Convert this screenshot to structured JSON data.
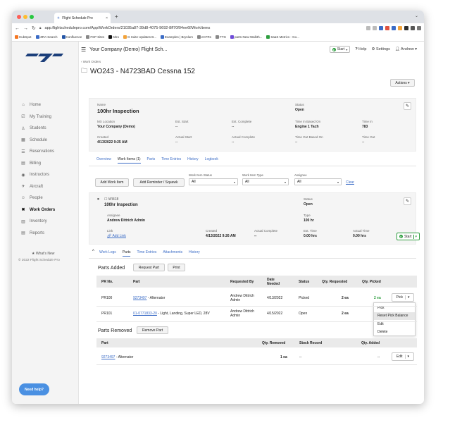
{
  "browser": {
    "tab_title": "Flight Schedule Pro",
    "url": "app.flightschedulepro.com/App/WorkOrders/21035a87-39d8-4075-9692-8ff70f04ee6f/WorkItems",
    "bookmarks": [
      "HubSpot",
      "JIRA Search",
      "Confluence",
      "FSP Sites",
      "Miro",
      "G Suite Updates B...",
      "Examples | Brynlum",
      "eCFRs",
      "FTG",
      "parts-New-Walkth...",
      "SaaS Metrics - Go..."
    ]
  },
  "header": {
    "company": "Your Company (Demo) Flight Sch...",
    "start_label": "Start",
    "help_label": "Help",
    "settings_label": "Settings",
    "user_label": "Andrew"
  },
  "sidebar": {
    "items": [
      {
        "label": "Home",
        "icon": "home-icon"
      },
      {
        "label": "My Training",
        "icon": "checklist-icon"
      },
      {
        "label": "Students",
        "icon": "student-icon"
      },
      {
        "label": "Schedule",
        "icon": "calendar-icon"
      },
      {
        "label": "Reservations",
        "icon": "list-icon"
      },
      {
        "label": "Billing",
        "icon": "billing-icon"
      },
      {
        "label": "Instructors",
        "icon": "instructor-icon"
      },
      {
        "label": "Aircraft",
        "icon": "aircraft-icon"
      },
      {
        "label": "People",
        "icon": "people-icon"
      },
      {
        "label": "Work Orders",
        "icon": "wrench-icon"
      },
      {
        "label": "Inventory",
        "icon": "inventory-icon"
      },
      {
        "label": "Reports",
        "icon": "reports-icon"
      }
    ],
    "whats_new": "What's New",
    "copyright": "© 2022 Flight Schedule Pro",
    "need_help": "Need help?"
  },
  "page": {
    "breadcrumb": "‹ Work Orders",
    "title": "WO243 - N4723BAD Cessna 152",
    "actions_label": "Actions"
  },
  "summary": {
    "name_label": "Name",
    "name": "100hr Inspection",
    "status_label": "Status",
    "status": "Open",
    "mx_location_label": "MX Location",
    "mx_location": "Your Company (Demo)",
    "est_start_label": "Est. Start",
    "est_start": "--",
    "est_complete_label": "Est. Complete",
    "est_complete": "--",
    "time_in_based_on_label": "Time In Based On",
    "time_in_based_on": "Engine 1 Tach",
    "time_in_label": "Time In",
    "time_in": "783",
    "created_label": "Created",
    "created": "4/13/2022 9:25 AM",
    "actual_start_label": "Actual Start",
    "actual_start": "--",
    "actual_complete_label": "Actual Complete",
    "actual_complete": "--",
    "time_out_based_on_label": "Time Out Based On",
    "time_out_based_on": "--",
    "time_out_label": "Time Out",
    "time_out": "--"
  },
  "wo_tabs": [
    "Overview",
    "Work Items (1)",
    "Parts",
    "Time Entries",
    "History",
    "Logbook"
  ],
  "filters": {
    "add_work_item": "Add Work Item",
    "add_reminder": "Add Reminder / Squawk",
    "status_label": "Work Item Status",
    "status_value": "All",
    "type_label": "Work Item Type",
    "type_value": "All",
    "assignee_label": "Assignee",
    "assignee_value": "All",
    "clear": "Clear"
  },
  "work_item": {
    "id": "WI418",
    "name": "100hr Inspection",
    "status_label": "Status",
    "status": "Open",
    "assignee_label": "Assignee",
    "assignee": "Andrew Dittrich Admin",
    "type_label": "Type",
    "type": "100 hr",
    "link_label": "Link",
    "link": "Add Link",
    "created_label": "Created",
    "created": "4/13/2022 9:26 AM",
    "actual_complete_label": "Actual Complete",
    "actual_complete": "--",
    "est_time_label": "Est. Time",
    "est_time": "0.00 hrs",
    "actual_time_label": "Actual Time",
    "actual_time": "0.00 hrs",
    "start_label": "Start"
  },
  "wi_tabs": [
    "Work Logs",
    "Parts",
    "Time Entries",
    "Attachments",
    "History"
  ],
  "parts_added": {
    "title": "Parts Added",
    "request_btn": "Request Part",
    "print_btn": "Print",
    "columns": [
      "PR No.",
      "Part",
      "Requested By",
      "Date Needed",
      "Status",
      "Qty. Requested",
      "Qty. Picked"
    ],
    "rows": [
      {
        "pr": "PR100",
        "part_no": "9273497",
        "part_desc": " - Alternator",
        "requested_by": "Andrew Dittrich Admin",
        "date": "4/13/2022",
        "status": "Picked",
        "qty_req": "2 ea",
        "qty_picked": "2 ea",
        "action": "Pick"
      },
      {
        "pr": "PR101",
        "part_no": "01-0771833-20",
        "part_desc": " - Light, Landing, Super LED, 28V",
        "requested_by": "Andrew Dittrich Admin",
        "date": "4/15/2022",
        "status": "Open",
        "qty_req": "2 ea",
        "qty_picked": "",
        "action": ""
      }
    ]
  },
  "dropdown": [
    "Pick",
    "Reset Pick Balance",
    "Edit",
    "Delete"
  ],
  "parts_removed": {
    "title": "Parts Removed",
    "remove_btn": "Remove Part",
    "columns": [
      "Part",
      "Qty. Removed",
      "Stock Record",
      "Qty. Added"
    ],
    "rows": [
      {
        "part_no": "9273497",
        "part_desc": " - Alternator",
        "qty_removed": "1 ea",
        "stock_record": "--",
        "qty_added": "--",
        "action": "Edit"
      }
    ]
  }
}
